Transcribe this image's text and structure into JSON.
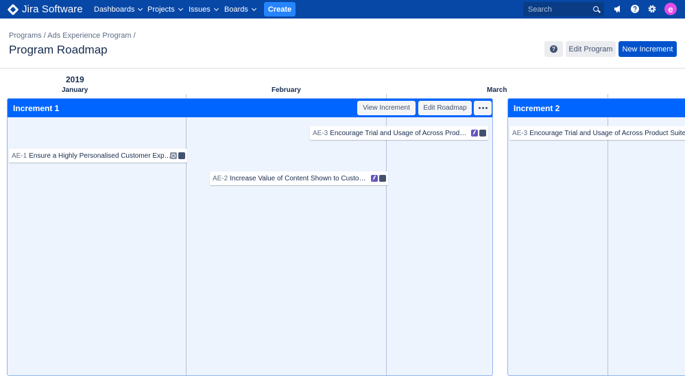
{
  "nav": {
    "product_name": "Jira Software",
    "items": [
      "Dashboards",
      "Projects",
      "Issues",
      "Boards"
    ],
    "create_label": "Create",
    "search_placeholder": "Search",
    "avatar_letter": "e",
    "brand_color": "#0747a6",
    "accent_color": "#2684ff",
    "avatar_color": "#e24ee9"
  },
  "breadcrumb": [
    "Programs",
    "/ Ads Experience Program",
    "/"
  ],
  "page": {
    "title": "Program Roadmap",
    "help_label": "?",
    "edit_program_label": "Edit Program",
    "new_increment_label": "New Increment"
  },
  "timeline": {
    "year": "2019",
    "months": [
      "January",
      "February",
      "March"
    ]
  },
  "increments": [
    {
      "title": "Increment 1",
      "view_label": "View Increment",
      "edit_label": "Edit Roadmap",
      "cards": [
        {
          "key": "AE-3",
          "title": "Encourage Trial and Usage of Across Prod…",
          "icons": [
            "bolt-icon",
            "square-icon"
          ]
        },
        {
          "key": "AE-1",
          "title": "Ensure a Highly Personalised Customer Exp…",
          "icons": [
            "ring-icon",
            "square-icon"
          ]
        },
        {
          "key": "AE-2",
          "title": "Increase Value of Content Shown to Custo…",
          "icons": [
            "bolt-icon",
            "square-icon"
          ]
        }
      ]
    },
    {
      "title": "Increment 2",
      "cards": [
        {
          "key": "AE-3",
          "title": "Encourage Trial and Usage of Across Product Suite"
        }
      ]
    }
  ]
}
